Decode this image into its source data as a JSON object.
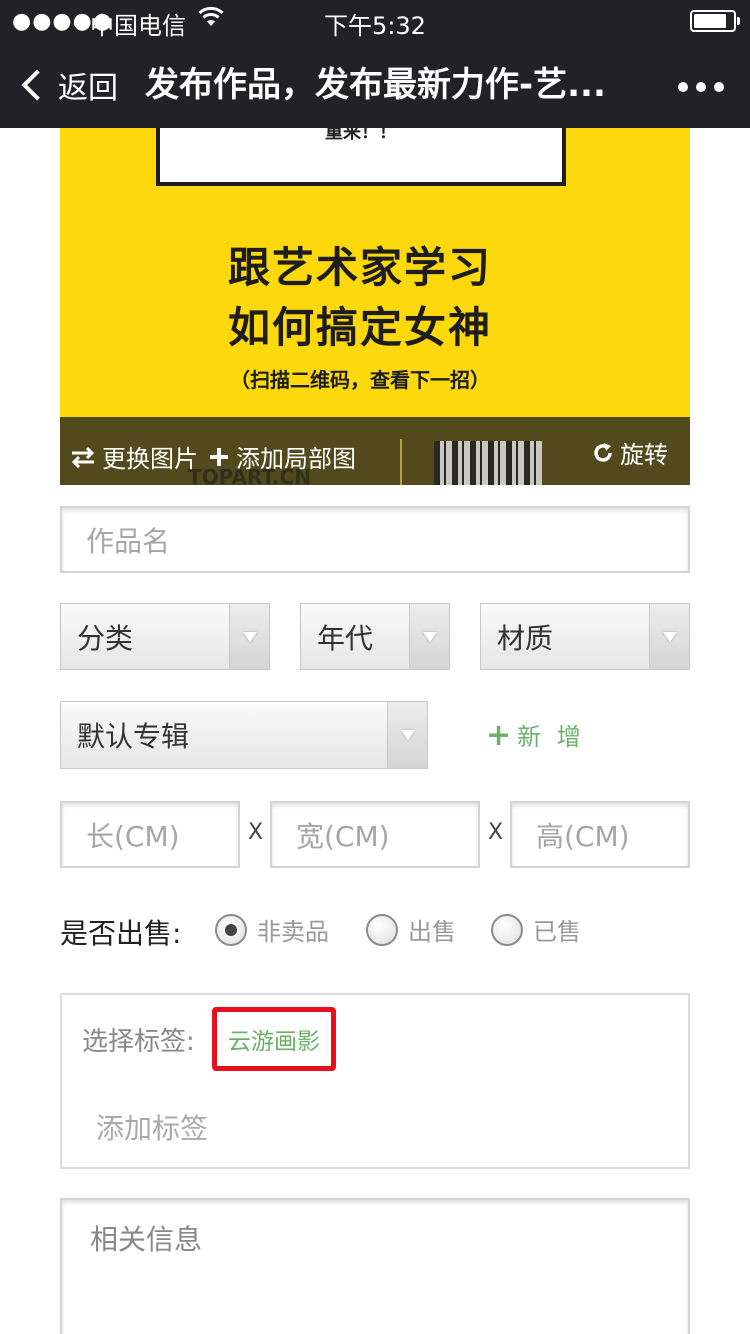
{
  "status_bar": {
    "signal": "●●●●●",
    "carrier": "中国电信",
    "time": "下午5:32",
    "battery_level": 0.85
  },
  "nav": {
    "back_label": "返回",
    "title": "发布作品，发布最新力作-艺..."
  },
  "poster": {
    "top_text": "重来！！",
    "line1": "跟艺术家学习",
    "line2": "如何搞定女神",
    "hint": "（扫描二维码，查看下一招）",
    "brand": "TOPART.CN",
    "swap_label": "更换图片",
    "add_detail_label": "添加局部图",
    "rotate_label": "旋转"
  },
  "form": {
    "work_name_placeholder": "作品名",
    "category": "分类",
    "era": "年代",
    "material": "材质",
    "album": "默认专辑",
    "add_new_label": "新 增",
    "length_placeholder": "长(CM)",
    "width_placeholder": "宽(CM)",
    "height_placeholder": "高(CM)",
    "times_sign": "X",
    "sale_label": "是否出售:",
    "sale_options": [
      "非卖品",
      "出售",
      "已售"
    ],
    "sale_selected": "非卖品",
    "tag_label": "选择标签:",
    "tag_chip": "云游画影",
    "tag_add_placeholder": "添加标签",
    "info_placeholder": "相关信息"
  }
}
